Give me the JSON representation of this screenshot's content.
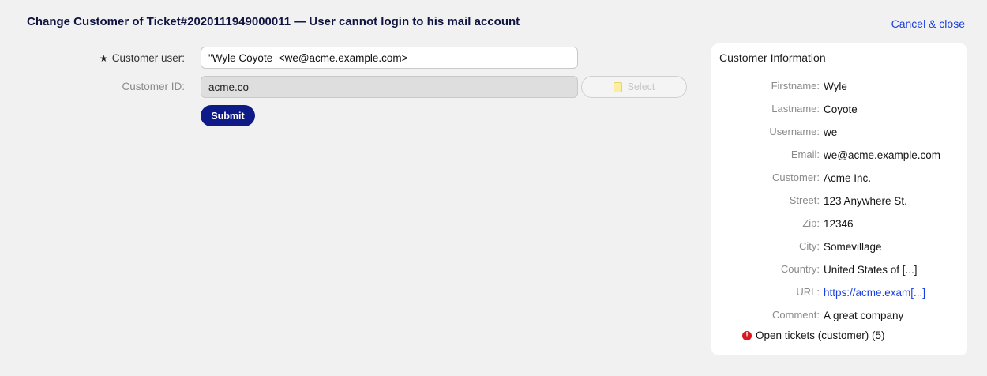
{
  "header": {
    "title": "Change Customer of Ticket#2020111949000011 — User cannot login to his mail account",
    "cancel_label": "Cancel & close"
  },
  "form": {
    "customer_user": {
      "required_mark": "★",
      "label": "Customer user:",
      "value": "\"Wyle Coyote  <we@acme.example.com>"
    },
    "customer_id": {
      "label": "Customer ID:",
      "value": "acme.co",
      "select_label": "Select"
    },
    "submit_label": "Submit"
  },
  "customer_info": {
    "title": "Customer Information",
    "fields": [
      {
        "key": "Firstname:",
        "value": "Wyle"
      },
      {
        "key": "Lastname:",
        "value": "Coyote"
      },
      {
        "key": "Username:",
        "value": "we"
      },
      {
        "key": "Email:",
        "value": "we@acme.example.com"
      },
      {
        "key": "Customer:",
        "value": "Acme Inc."
      },
      {
        "key": "Street:",
        "value": "123 Anywhere St."
      },
      {
        "key": "Zip:",
        "value": "12346"
      },
      {
        "key": "City:",
        "value": "Somevillage"
      },
      {
        "key": "Country:",
        "value": "United States of [...]"
      },
      {
        "key": "URL:",
        "value": "https://acme.exam[...]"
      },
      {
        "key": "Comment:",
        "value": "A great company"
      }
    ],
    "open_tickets_label": "Open tickets (customer) (5)",
    "alert_icon": "exclamation-circle-icon",
    "alert_color": "#d8191f"
  },
  "colors": {
    "accent": "#0e1a87",
    "link": "#1a3fe0"
  }
}
